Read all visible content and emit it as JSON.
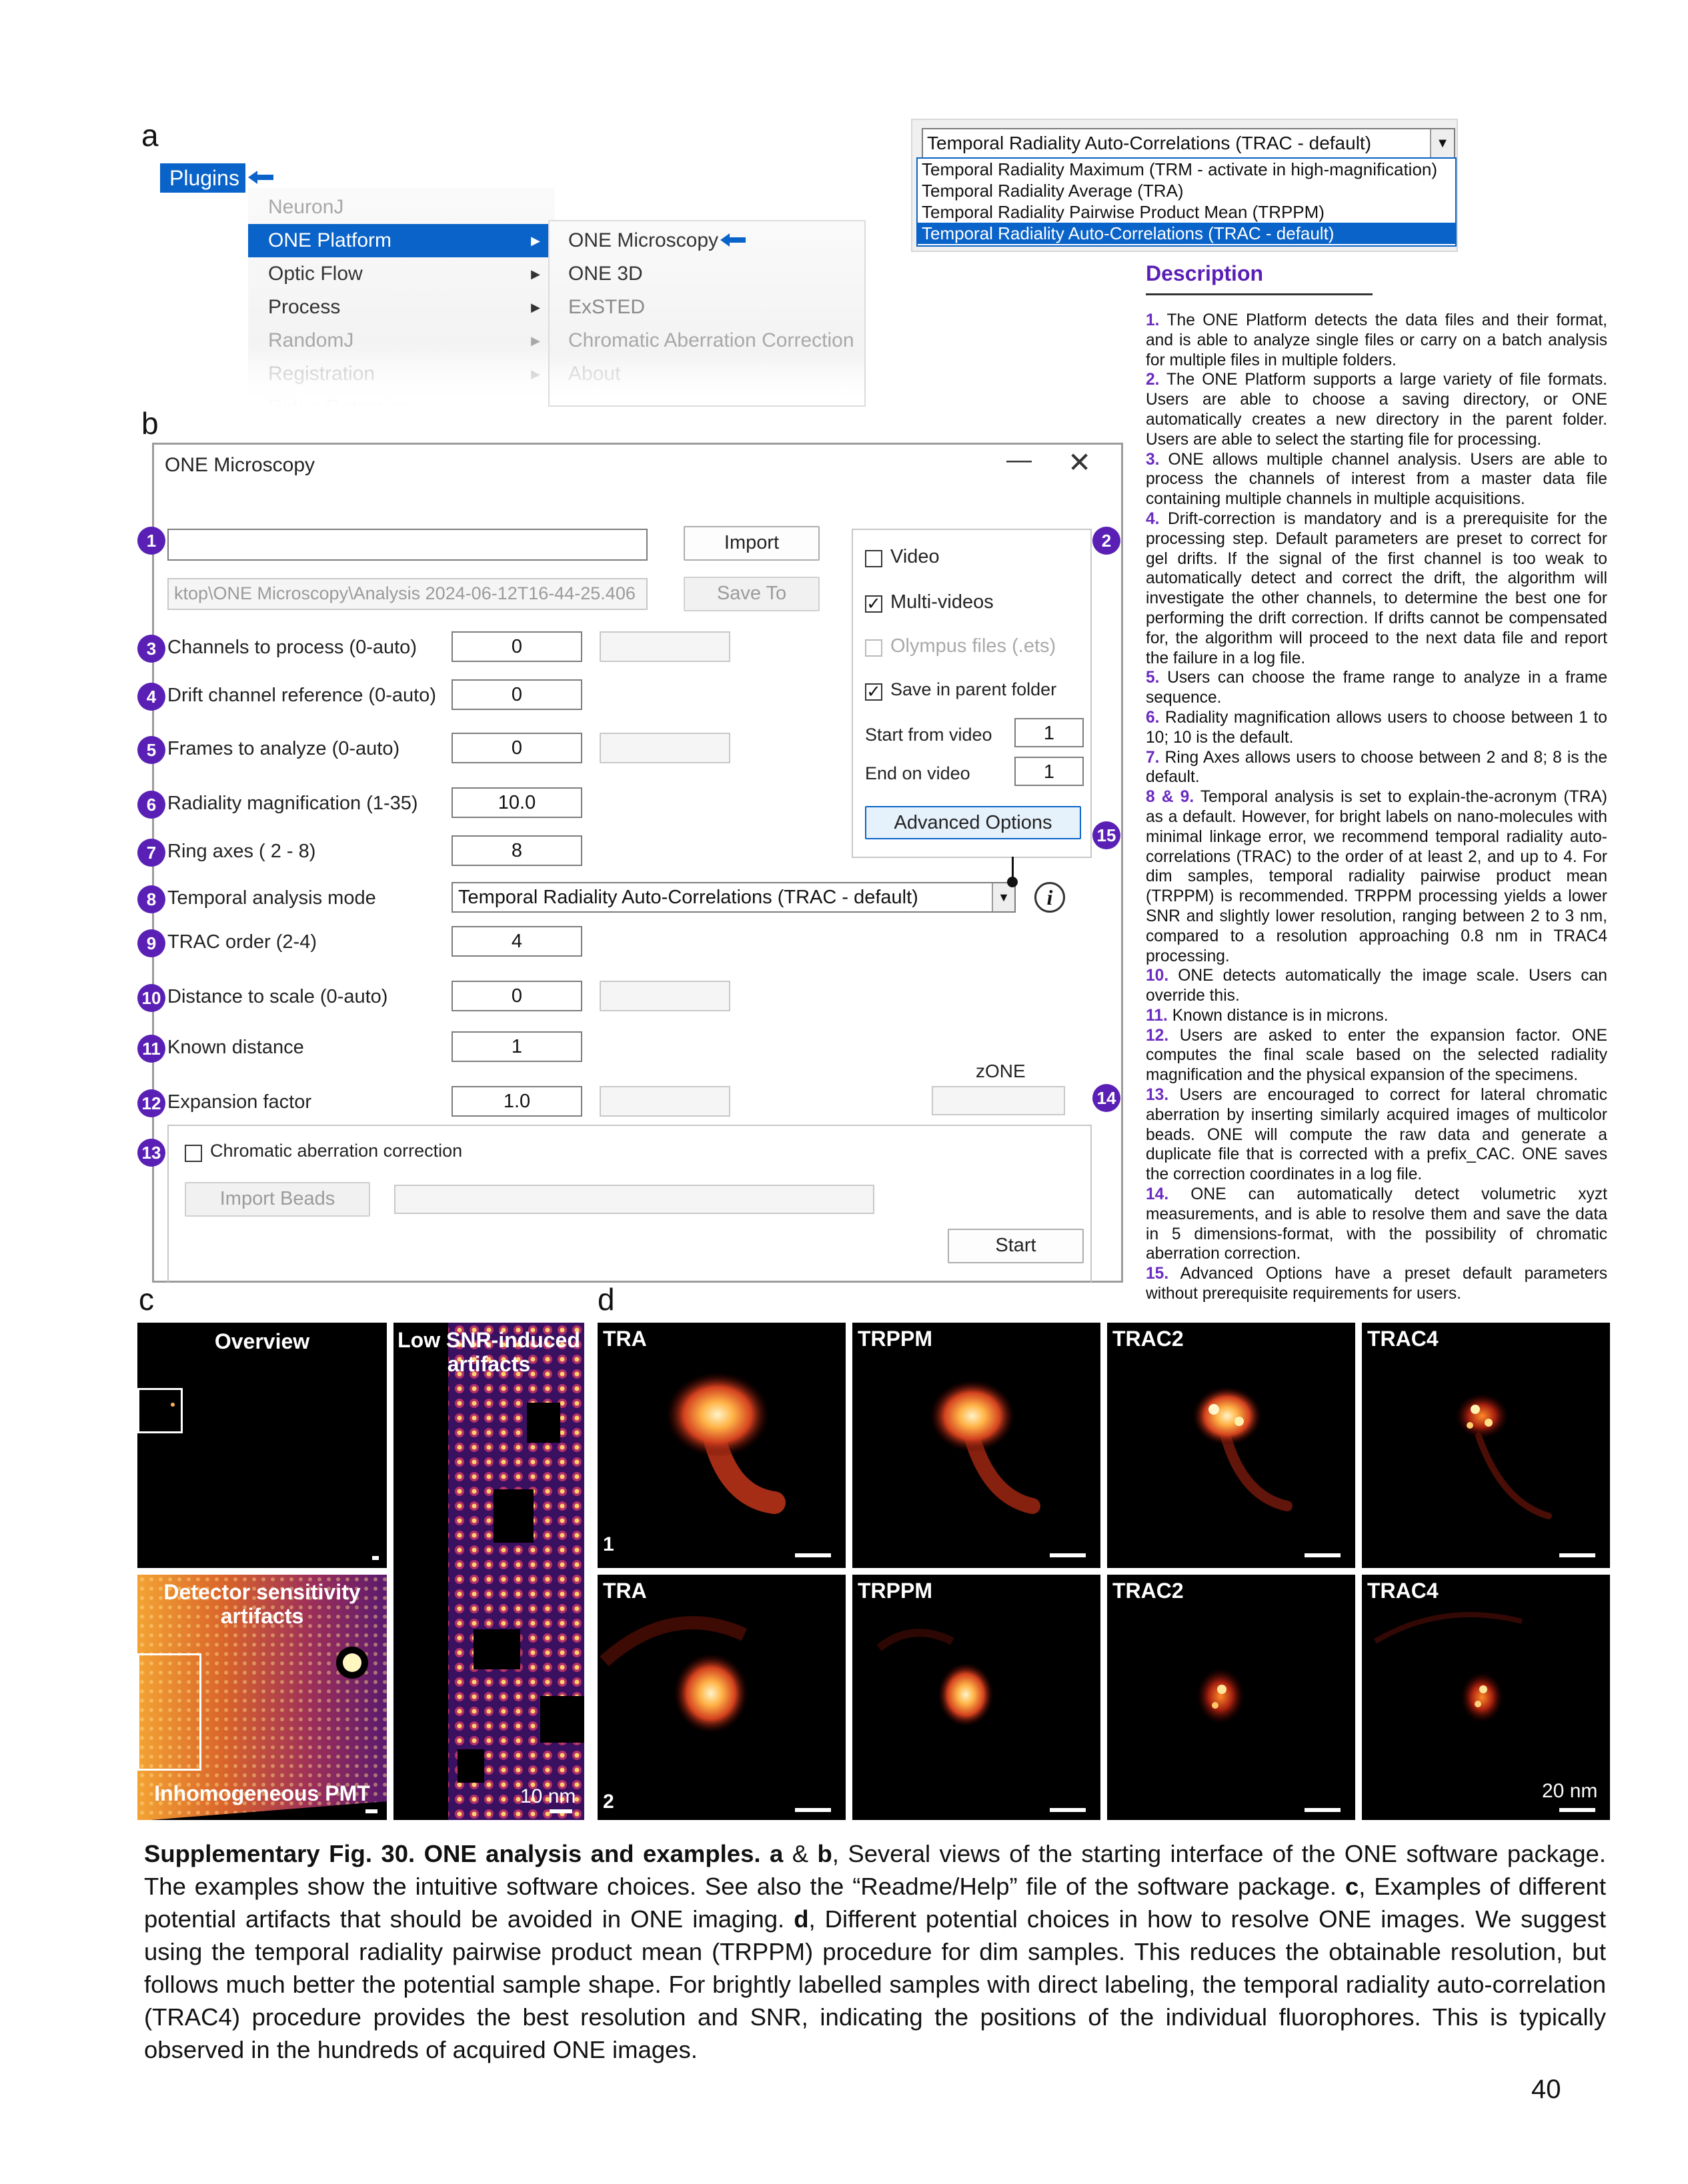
{
  "panel_letters": {
    "a": "a",
    "b": "b",
    "c": "c",
    "d": "d"
  },
  "imagej_menu": {
    "menubar_item": "Plugins",
    "level1": [
      "NeuronJ",
      "ONE Platform",
      "Optic Flow",
      "Process",
      "RandomJ",
      "Registration",
      "Ridge Detection"
    ],
    "level2": [
      "ONE Microscopy",
      "ONE 3D",
      "ExSTED",
      "Chromatic Aberration Correction",
      "About"
    ]
  },
  "temporal_dropdown": {
    "current": "Temporal Radiality Auto-Correlations (TRAC - default)",
    "options": [
      "Temporal Radiality Maximum (TRM - activate in high-magnification)",
      "Temporal Radiality Average (TRA)",
      "Temporal Radiality Pairwise Product Mean (TRPPM)",
      "Temporal Radiality Auto-Correlations (TRAC - default)"
    ]
  },
  "description": {
    "title": "Description",
    "items": [
      {
        "num": "1.",
        "text": "The ONE Platform detects the data files and their format, and is able to analyze single files or carry on a batch analysis for multiple files in multiple folders."
      },
      {
        "num": "2.",
        "text": "The ONE Platform supports a large variety of file formats. Users are able to choose a saving directory, or ONE automatically creates a new directory in the parent folder. Users are able to select the starting file for processing."
      },
      {
        "num": "3.",
        "text": "ONE allows multiple channel analysis. Users are able to process the channels of interest from a master data file containing multiple channels in multiple acquisitions."
      },
      {
        "num": "4.",
        "text": "Drift-correction is mandatory and is a prerequisite for the processing step. Default parameters are preset to correct for gel drifts. If the signal of the first channel is too weak to automatically detect and correct the drift, the algorithm will investigate the other channels, to determine the best one for performing the drift correction. If drifts cannot be compensated for, the algorithm will proceed to the next data file and report the failure in a log file."
      },
      {
        "num": "5.",
        "text": "Users can choose the frame range to analyze in a frame sequence."
      },
      {
        "num": "6.",
        "text": "Radiality magnification allows users to choose between 1 to 10; 10 is the default."
      },
      {
        "num": "7.",
        "text": "Ring Axes allows users to choose between 2 and 8;  8 is the default."
      },
      {
        "num": "8 & 9.",
        "text": "Temporal analysis is set to explain-the-acronym (TRA) as a default. However, for bright labels on nano-molecules with minimal linkage error, we recommend temporal radiality auto-correlations (TRAC) to the order of at least 2, and up to 4. For dim samples, temporal radiality pairwise product mean (TRPPM) is recommended. TRPPM processing yields a lower SNR and slightly lower resolution, ranging between 2 to 3 nm, compared to a resolution approaching 0.8 nm in TRAC4 processing."
      },
      {
        "num": "10.",
        "text": "ONE detects automatically the image scale. Users can override this."
      },
      {
        "num": "11.",
        "text": "Known distance is in microns."
      },
      {
        "num": "12.",
        "text": "Users are asked to enter the expansion factor. ONE computes the final scale based on the selected radiality magnification and the physical expansion of the specimens."
      },
      {
        "num": "13.",
        "text": "Users are encouraged to correct for lateral chromatic aberration by inserting similarly acquired images of multicolor beads. ONE will compute the raw data and generate a duplicate file that is corrected with a prefix_CAC. ONE saves the correction coordinates in a log file."
      },
      {
        "num": "14.",
        "text": "ONE can automatically detect volumetric xyzt measurements, and is able to resolve them and save the data in 5 dimensions-format, with the possibility of chromatic aberration correction."
      },
      {
        "num": "15.",
        "text": "Advanced Options have a preset default parameters without prerequisite requirements for users."
      }
    ]
  },
  "dialog": {
    "title": "ONE Microscopy",
    "minimize": "—",
    "close": "✕",
    "path_value": "",
    "import_label": "Import",
    "save_path": "ktop\\ONE Microscopy\\Analysis 2024-06-12T16-44-25.406",
    "save_to_label": "Save To",
    "fields": [
      {
        "badge": "3",
        "label": "Channels to process (0-auto)",
        "value": "0",
        "extra": true
      },
      {
        "badge": "4",
        "label": "Drift channel reference (0-auto)",
        "value": "0",
        "extra": false
      },
      {
        "badge": "5",
        "label": "Frames to analyze (0-auto)",
        "value": "0",
        "extra": true
      },
      {
        "badge": "6",
        "label": "Radiality magnification (1-35)",
        "value": "10.0",
        "extra": false
      },
      {
        "badge": "7",
        "label": "Ring axes ( 2 - 8)",
        "value": "8",
        "extra": false
      },
      {
        "badge": "8",
        "label": "Temporal analysis mode",
        "value": "",
        "extra": false
      },
      {
        "badge": "9",
        "label": "TRAC order (2-4)",
        "value": "4",
        "extra": false
      },
      {
        "badge": "10",
        "label": "Distance to scale (0-auto)",
        "value": "0",
        "extra": true
      },
      {
        "badge": "11",
        "label": "Known distance",
        "value": "1",
        "extra": false
      },
      {
        "badge": "12",
        "label": "Expansion factor",
        "value": "1.0",
        "extra": true
      }
    ],
    "temporal_mode_value": "Temporal Radiality Auto-Correlations (TRAC - default)",
    "info_icon": "i",
    "options_group": {
      "video": "Video",
      "multi_videos": "Multi-videos",
      "olympus": "Olympus files (.ets)",
      "save_parent": "Save in parent folder",
      "start_from_video": "Start from video",
      "start_value": "1",
      "end_on_video": "End on video",
      "end_value": "1",
      "advanced": "Advanced Options"
    },
    "zone_label": "zONE",
    "chromatic": "Chromatic aberration correction",
    "import_beads": "Import Beads",
    "start": "Start",
    "badges": {
      "b1": "1",
      "b2": "2",
      "b13": "13",
      "b14": "14",
      "b15": "15"
    }
  },
  "panel_c": {
    "overview": "Overview",
    "low_snr": "Low SNR-induced artifacts",
    "detector": "Detector sensitivity artifacts",
    "pmt": "Inhomogeneous PMT",
    "scale": "10 nm"
  },
  "panel_d": {
    "columns": [
      "TRA",
      "TRPPM",
      "TRAC2",
      "TRAC4"
    ],
    "row_labels": [
      "1",
      "2"
    ],
    "scale": "20 nm"
  },
  "caption": {
    "bold_lead": "Supplementary Fig. 30. ONE analysis and examples. a",
    "amp": " & ",
    "b": "b",
    "text1": ", Several views of the starting interface of the ONE software package. The examples show the intuitive software choices. See also the “Readme/Help” file of the software package. ",
    "c": "c",
    "text2": ", Examples of different potential artifacts that should be avoided in ONE imaging. ",
    "d": "d",
    "text3": ", Different potential choices in how to resolve ONE images. We suggest using the temporal radiality pairwise product mean (TRPPM) procedure for dim samples. This reduces the obtainable resolution, but follows much better the potential sample shape. For brightly labelled samples with direct labeling, the temporal radiality auto-correlation (TRAC4) procedure provides the best resolution and SNR, indicating the positions of the individual fluorophores.  This is typically observed in the hundreds of acquired ONE images."
  },
  "page_number": "40",
  "colors": {
    "accent_blue": "#0a63c9",
    "badge_purple": "#5a1fb5",
    "desc_number": "#6b2bbf"
  }
}
